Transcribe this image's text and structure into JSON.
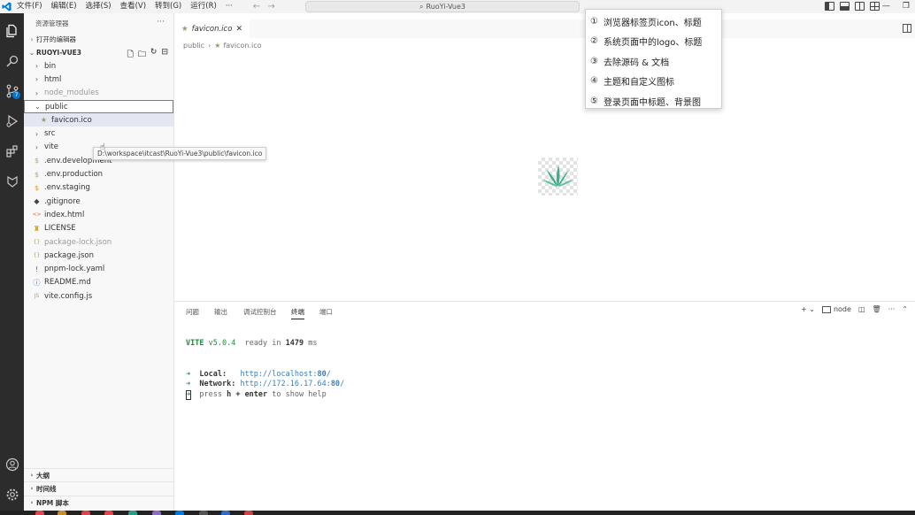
{
  "titlebar": {
    "menus": [
      "文件(F)",
      "编辑(E)",
      "选择(S)",
      "查看(V)",
      "转到(G)",
      "运行(R)",
      "···"
    ],
    "search_text": "RuoYi-Vue3"
  },
  "activitybar": {
    "icons": [
      "files-icon",
      "search-icon",
      "source-control-icon",
      "run-debug-icon",
      "extensions-icon",
      "remote-icon"
    ],
    "scm_badge": "7"
  },
  "sidebar": {
    "title": "资源管理器",
    "more": "···",
    "open_editors": "打开的编辑器",
    "project": "RUOYI-VUE3",
    "tree": [
      {
        "label": "bin",
        "type": "folder",
        "indent": 0
      },
      {
        "label": "html",
        "type": "folder",
        "indent": 0
      },
      {
        "label": "node_modules",
        "type": "folder",
        "indent": 0,
        "dim": true
      },
      {
        "label": "public",
        "type": "folder-open",
        "indent": 0,
        "selected": true
      },
      {
        "label": "favicon.ico",
        "type": "ico",
        "indent": 1,
        "active": true
      },
      {
        "label": "src",
        "type": "folder",
        "indent": 0
      },
      {
        "label": "vite",
        "type": "folder",
        "indent": 0
      },
      {
        "label": ".env.development",
        "type": "env",
        "indent": 0
      },
      {
        "label": ".env.production",
        "type": "env",
        "indent": 0
      },
      {
        "label": ".env.staging",
        "type": "env",
        "indent": 0
      },
      {
        "label": ".gitignore",
        "type": "git",
        "indent": 0
      },
      {
        "label": "index.html",
        "type": "html",
        "indent": 0
      },
      {
        "label": "LICENSE",
        "type": "license",
        "indent": 0
      },
      {
        "label": "package-lock.json",
        "type": "json",
        "indent": 0,
        "dim": true
      },
      {
        "label": "package.json",
        "type": "json",
        "indent": 0
      },
      {
        "label": "pnpm-lock.yaml",
        "type": "yaml",
        "indent": 0
      },
      {
        "label": "README.md",
        "type": "md",
        "indent": 0
      },
      {
        "label": "vite.config.js",
        "type": "js",
        "indent": 0
      }
    ],
    "tooltip": "D:\\workspace\\itcast\\RuoYi-Vue3\\public\\favicon.ico",
    "bottom_sections": [
      "大纲",
      "时间线",
      "NPM 脚本"
    ]
  },
  "editor": {
    "tab_label": "favicon.ico",
    "breadcrumb": [
      "public",
      "favicon.ico"
    ]
  },
  "callout": {
    "items": [
      {
        "num": "①",
        "text": "浏览器标签页icon、标题"
      },
      {
        "num": "②",
        "text": "系统页面中的logo、标题"
      },
      {
        "num": "③",
        "text": "去除源码 & 文档"
      },
      {
        "num": "④",
        "text": "主题和自定义图标"
      },
      {
        "num": "⑤",
        "text": "登录页面中标题、背景图"
      }
    ]
  },
  "panel": {
    "tabs": [
      "问题",
      "输出",
      "调试控制台",
      "终端",
      "端口"
    ],
    "active_tab": "终端",
    "terminal_label": "node",
    "terminal": {
      "vite_name": "VITE",
      "vite_version": "v5.0.4",
      "ready_text": "ready in",
      "ready_ms": "1479",
      "ms_unit": "ms",
      "arrow": "➜",
      "local_label": "Local:",
      "local_url_prefix": "http://localhost:",
      "local_port": "80",
      "local_url_suffix": "/",
      "network_label": "Network:",
      "network_url_prefix": "http://172.16.17.64:",
      "network_port": "80",
      "network_url_suffix": "/",
      "help_pre": "press",
      "help_key": "h + enter",
      "help_post": "to show help"
    }
  },
  "colors": {
    "accent": "#0078d4",
    "activity_bg": "#2c2c2c",
    "vite_green": "#1d8a3a",
    "selection_border": "#2d8cff",
    "logo_green": "#3fae8c"
  }
}
